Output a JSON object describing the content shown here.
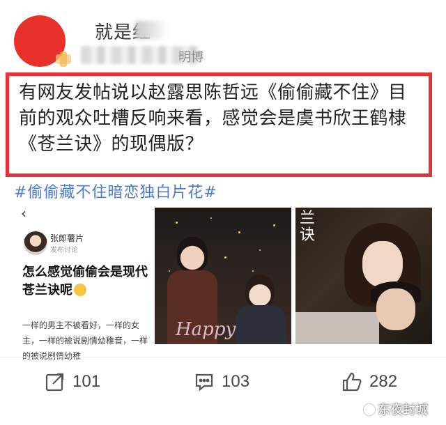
{
  "post": {
    "username": "就是红",
    "meta": "明博",
    "text": "有网友发帖说以赵露思陈哲远《偷偷藏不住》目前的观众吐槽反响来看，感觉会是虞书欣王鹤棣《苍兰诀》的现偶版？",
    "topic": "#偷偷藏不住暗恋独白片花#"
  },
  "card": {
    "back": "‹",
    "author": "张郎薯片",
    "sub": "发布讨论",
    "title": "怎么感觉偷偷会是现代苍兰诀呢",
    "desc": "一样的男主不被看好，一样的女主，一样的被说剧情幼稚音，一样的被说剧情幼稚"
  },
  "poster1": {
    "script": "Happy"
  },
  "poster2": {
    "calligraphy": "兰\n诀"
  },
  "actions": {
    "repost_count": "101",
    "comment_count": "103",
    "like_count": "282"
  },
  "watermark": {
    "text": "东夜封城"
  },
  "colors": {
    "highlight_border": "#e8323a",
    "topic_link": "#4d7bc9",
    "avatar": "#e8312a"
  }
}
